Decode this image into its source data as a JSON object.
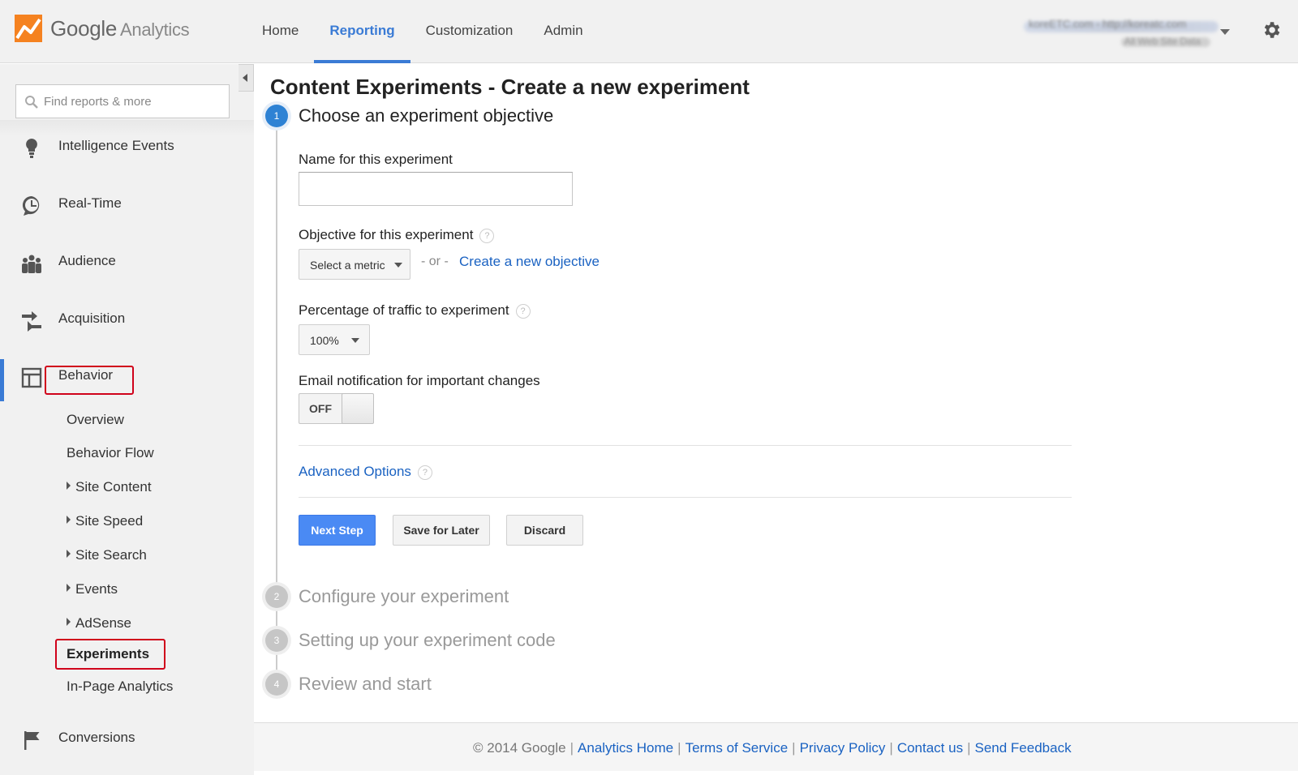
{
  "header": {
    "logo_brand": "Google",
    "logo_product": "Analytics",
    "nav": [
      {
        "label": "Home",
        "active": false
      },
      {
        "label": "Reporting",
        "active": true
      },
      {
        "label": "Customization",
        "active": false
      },
      {
        "label": "Admin",
        "active": false
      }
    ],
    "account_line1": "koreETC.com - http://koreatc.com",
    "account_line2": "All Web Site Data",
    "accent_color": "#3a7bd5"
  },
  "sidebar": {
    "search_placeholder": "Find reports & more",
    "items": [
      {
        "label": "Intelligence Events",
        "icon": "lightbulb-icon"
      },
      {
        "label": "Real-Time",
        "icon": "clock-icon"
      },
      {
        "label": "Audience",
        "icon": "people-icon"
      },
      {
        "label": "Acquisition",
        "icon": "arrows-icon"
      },
      {
        "label": "Behavior",
        "icon": "layout-icon"
      },
      {
        "label": "Conversions",
        "icon": "flag-icon"
      }
    ],
    "behavior_sub": [
      {
        "label": "Overview"
      },
      {
        "label": "Behavior Flow"
      },
      {
        "label": "Site Content"
      },
      {
        "label": "Site Speed"
      },
      {
        "label": "Site Search"
      },
      {
        "label": "Events"
      },
      {
        "label": "AdSense"
      },
      {
        "label": "Experiments"
      },
      {
        "label": "In-Page Analytics"
      }
    ]
  },
  "main": {
    "title": "Content Experiments - Create a new experiment",
    "steps": [
      {
        "num": "1",
        "title": "Choose an experiment objective"
      },
      {
        "num": "2",
        "title": "Configure your experiment"
      },
      {
        "num": "3",
        "title": "Setting up your experiment code"
      },
      {
        "num": "4",
        "title": "Review and start"
      }
    ],
    "name_label": "Name for this experiment",
    "name_value": "",
    "objective_label": "Objective for this experiment",
    "objective_select": "Select a metric",
    "or_text": "- or -",
    "create_objective_link": "Create a new objective",
    "traffic_label": "Percentage of traffic to experiment",
    "traffic_value": "100%",
    "email_label": "Email notification for important changes",
    "email_toggle": "OFF",
    "advanced_options": "Advanced Options",
    "help_glyph": "?",
    "buttons": {
      "next": "Next Step",
      "save": "Save for Later",
      "discard": "Discard"
    }
  },
  "footer": {
    "copyright": "© 2014 Google",
    "links": [
      "Analytics Home",
      "Terms of Service",
      "Privacy Policy",
      "Contact us",
      "Send Feedback"
    ]
  }
}
